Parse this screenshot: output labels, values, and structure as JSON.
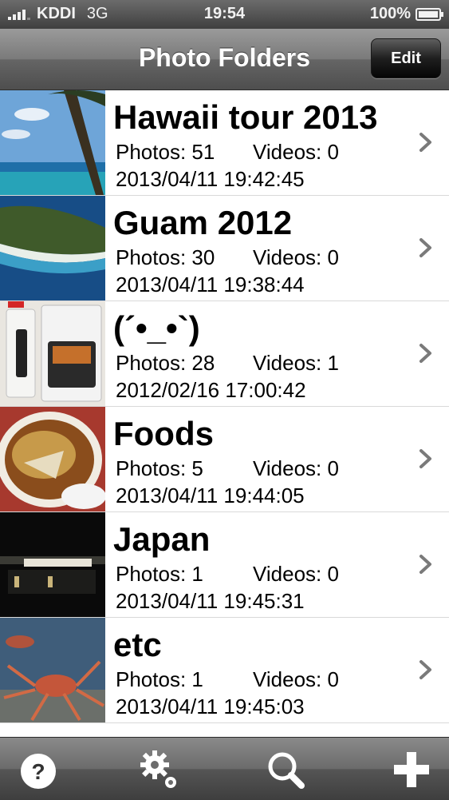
{
  "status_bar": {
    "carrier": "KDDI",
    "network": "3G",
    "time": "19:54",
    "battery": "100%"
  },
  "nav": {
    "title": "Photo Folders",
    "edit_label": "Edit"
  },
  "folders": [
    {
      "title": "Hawaii tour 2013",
      "photos": "Photos: 51",
      "videos": "Videos: 0",
      "date": "2013/04/11 19:42:45"
    },
    {
      "title": "Guam 2012",
      "photos": "Photos: 30",
      "videos": "Videos: 0",
      "date": "2013/04/11 19:38:44"
    },
    {
      "title": "(´•_•`)",
      "photos": "Photos: 28",
      "videos": "Videos: 1",
      "date": "2012/02/16 17:00:42"
    },
    {
      "title": "Foods",
      "photos": "Photos: 5",
      "videos": "Videos: 0",
      "date": "2013/04/11 19:44:05"
    },
    {
      "title": "Japan",
      "photos": "Photos: 1",
      "videos": "Videos: 0",
      "date": "2013/04/11 19:45:31"
    },
    {
      "title": "etc",
      "photos": "Photos: 1",
      "videos": "Videos: 0",
      "date": "2013/04/11 19:45:03"
    }
  ],
  "toolbar": {
    "icons": [
      "help-icon",
      "settings-icon",
      "search-icon",
      "add-icon"
    ]
  }
}
